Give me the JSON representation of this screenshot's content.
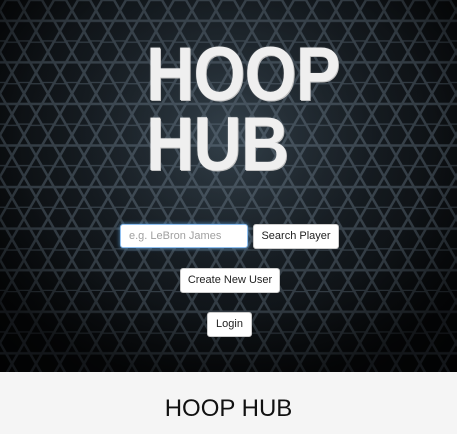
{
  "hero": {
    "logo_line1": "HOOP",
    "logo_line2": "HUB",
    "search": {
      "placeholder": "e.g. LeBron James",
      "value": ""
    },
    "search_button_label": "Search Player",
    "create_user_label": "Create New User",
    "login_label": "Login"
  },
  "footer": {
    "title": "HOOP HUB"
  },
  "colors": {
    "hero_background": "#1c242b",
    "hex_line": "#4c5a66",
    "footer_background": "#f5f5f5",
    "input_focus_border": "#8fbff0"
  }
}
